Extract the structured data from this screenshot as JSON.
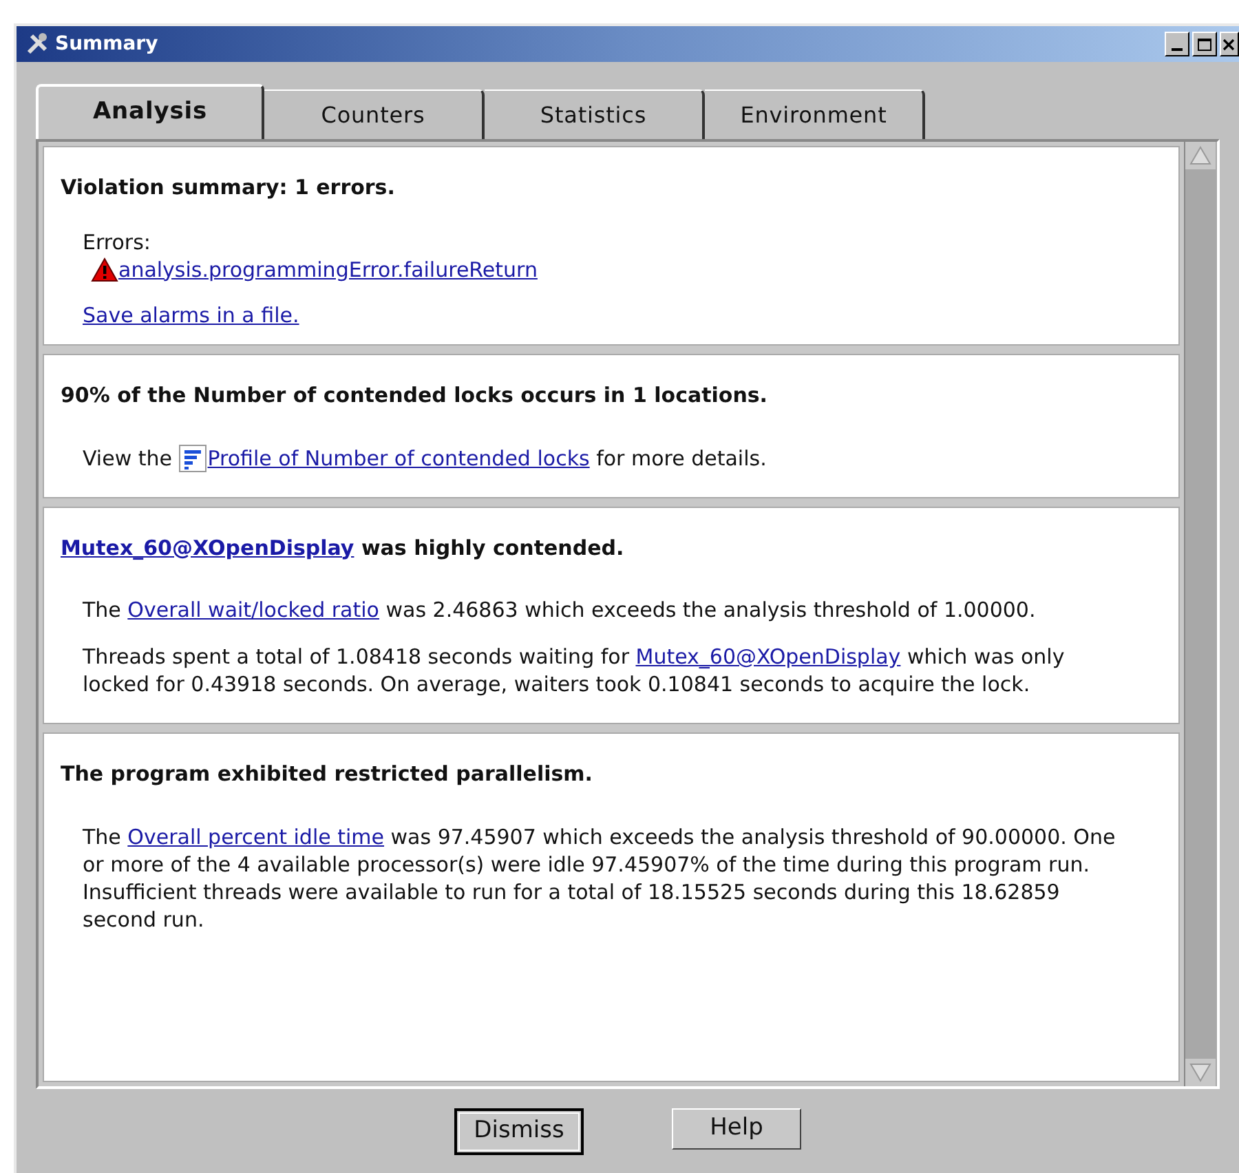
{
  "window": {
    "title": "Summary"
  },
  "tabs": [
    {
      "label": "Analysis",
      "selected": true
    },
    {
      "label": "Counters",
      "selected": false
    },
    {
      "label": "Statistics",
      "selected": false
    },
    {
      "label": "Environment",
      "selected": false
    }
  ],
  "sections": [
    {
      "heading": [
        {
          "kind": "text",
          "text": "Violation summary: 1 errors."
        }
      ],
      "items": [
        {
          "kind": "label",
          "text": "Errors:"
        },
        {
          "kind": "alarm",
          "text": "analysis.programmingError.failureReturn"
        },
        {
          "kind": "link",
          "text": "Save alarms in a file."
        }
      ]
    },
    {
      "heading": [
        {
          "kind": "text",
          "text": "90% of the Number of contended locks occurs in 1 locations."
        }
      ],
      "items": [
        {
          "kind": "paragraph",
          "segments": [
            {
              "kind": "text",
              "text": "View the "
            },
            {
              "kind": "profile_link",
              "text": "Profile of Number of contended locks"
            },
            {
              "kind": "text",
              "text": " for more details."
            }
          ]
        }
      ]
    },
    {
      "heading": [
        {
          "kind": "link",
          "text": "Mutex_60@XOpenDisplay"
        },
        {
          "kind": "text",
          "text": " was highly contended."
        }
      ],
      "items": [
        {
          "kind": "paragraph",
          "segments": [
            {
              "kind": "text",
              "text": "The "
            },
            {
              "kind": "link",
              "text": "Overall wait/locked ratio"
            },
            {
              "kind": "text",
              "text": " was 2.46863 which exceeds the analysis threshold of 1.00000."
            }
          ]
        },
        {
          "kind": "paragraph",
          "segments": [
            {
              "kind": "text",
              "text": "Threads spent a total of 1.08418  seconds waiting for "
            },
            {
              "kind": "link",
              "text": "Mutex_60@XOpenDisplay"
            },
            {
              "kind": "text",
              "text": " which was only locked for 0.43918 seconds.  On average, waiters took 0.10841 seconds to acquire the lock."
            }
          ]
        }
      ]
    },
    {
      "heading": [
        {
          "kind": "text",
          "text": "The program exhibited restricted parallelism."
        }
      ],
      "items": [
        {
          "kind": "paragraph",
          "segments": [
            {
              "kind": "text",
              "text": "The "
            },
            {
              "kind": "link",
              "text": "Overall percent idle time"
            },
            {
              "kind": "text",
              "text": " was 97.45907 which exceeds the analysis threshold of 90.00000. One or more of the 4 available processor(s) were idle 97.45907% of the time during this program run. Insufficient threads were available to run for a total of 18.15525 seconds during this 18.62859 second run."
            }
          ]
        }
      ]
    }
  ],
  "buttons": [
    {
      "label": "Dismiss",
      "default": true
    },
    {
      "label": "Help",
      "default": false
    }
  ]
}
